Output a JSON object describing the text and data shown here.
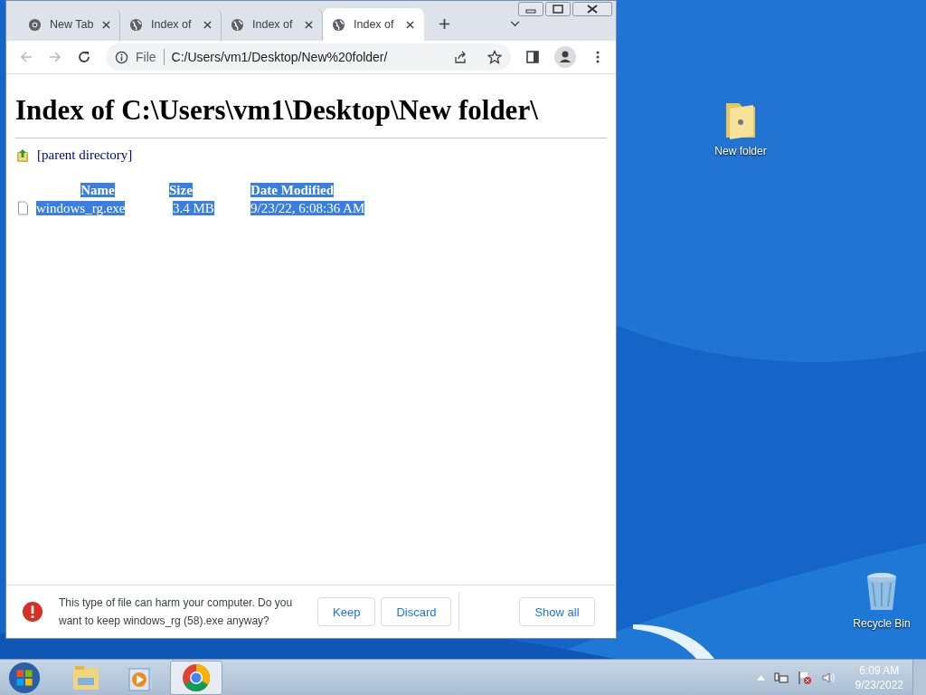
{
  "browser": {
    "tabs": [
      {
        "kind": "chrome",
        "label": "New Tab",
        "selected": false
      },
      {
        "kind": "globe",
        "label": "Index of",
        "selected": false
      },
      {
        "kind": "globe",
        "label": "Index of",
        "selected": false
      },
      {
        "kind": "globe",
        "label": "Index of",
        "selected": true
      }
    ],
    "address": {
      "scheme": "File",
      "url": "C:/Users/vm1/Desktop/New%20folder/"
    },
    "page": {
      "heading": "Index of C:\\Users\\vm1\\Desktop\\New folder\\",
      "parent_link": "[parent directory]",
      "columns": [
        {
          "label": "Name",
          "highlighted": true
        },
        {
          "label": "Size",
          "highlighted": true
        },
        {
          "label": "Date Modified",
          "highlighted": true
        }
      ],
      "rows": [
        {
          "cells": [
            "windows_rg.exe",
            "3.4 MB",
            "9/23/22, 6:08:36 AM"
          ],
          "highlighted": true
        }
      ]
    },
    "download_bar": {
      "message": "This type of file can harm your computer. Do you want to keep windows_rg (58).exe anyway?",
      "buttons": [
        "Keep",
        "Discard"
      ],
      "show_all": "Show all"
    }
  },
  "desktop_icons": [
    {
      "kind": "folder",
      "label": "New folder"
    },
    {
      "kind": "recycle",
      "label": "Recycle Bin"
    }
  ],
  "taskbar": {
    "apps": [
      {
        "kind": "explorer",
        "selected": false
      },
      {
        "kind": "media",
        "selected": false
      },
      {
        "kind": "chrome",
        "selected": true
      }
    ],
    "clock": {
      "time": "6:09 AM",
      "date": "9/23/2022"
    }
  }
}
